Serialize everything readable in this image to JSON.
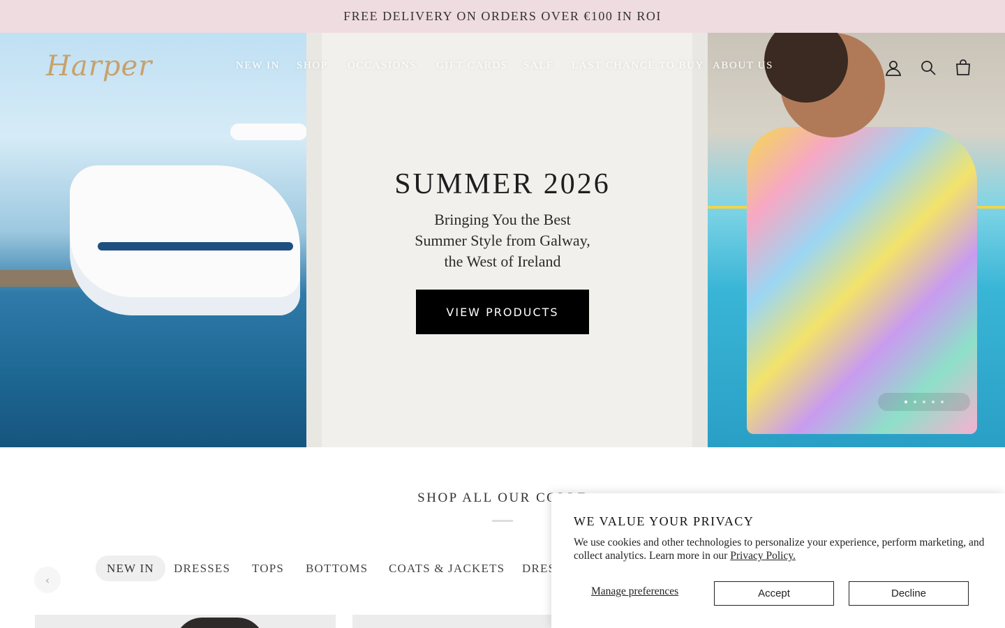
{
  "announcement": {
    "text": "FREE DELIVERY ON ORDERS OVER €100 IN ROI"
  },
  "header": {
    "logo": "Harper",
    "nav": [
      "NEW IN",
      "SHOP",
      "OCCASIONS",
      "GIFT CARDS",
      "SALE",
      "LAST CHANCE TO BUY",
      "ABOUT US"
    ],
    "icons": [
      "account-icon",
      "search-icon",
      "cart-icon"
    ]
  },
  "hero": {
    "title": "SUMMER 2026",
    "subtitle_lines": [
      "Bringing You the Best",
      "Summer Style from Galway,",
      "the West of Ireland"
    ],
    "cta": "VIEW PRODUCTS",
    "slide_count": 5,
    "active_slide": 1
  },
  "collections": {
    "title": "SHOP ALL OUR COLLE",
    "tabs": [
      "NEW IN",
      "DRESSES",
      "TOPS",
      "BOTTOMS",
      "COATS & JACKETS",
      "DRES"
    ],
    "active_tab": "NEW IN",
    "prev_icon": "chevron-left-icon"
  },
  "cookie": {
    "title": "WE VALUE YOUR PRIVACY",
    "body_prefix": "We use cookies and other technologies to personalize your experience, perform marketing, and collect analytics. Learn more in our ",
    "link": "Privacy Policy.",
    "manage": "Manage preferences",
    "accept": "Accept",
    "decline": "Decline"
  },
  "colors": {
    "announcement_bg": "#efdce1",
    "logo_gold": "#c7a16b",
    "cta_bg": "#000000"
  }
}
